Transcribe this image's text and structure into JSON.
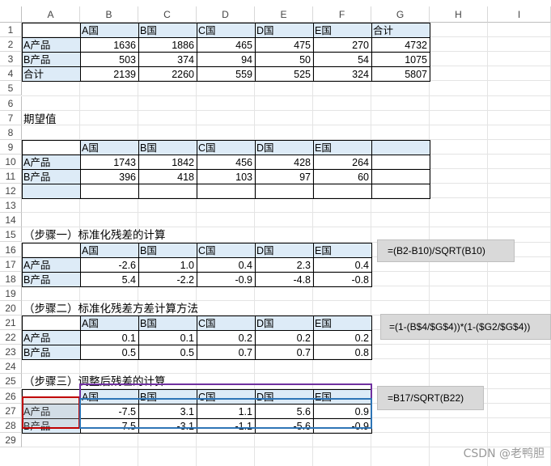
{
  "columns": [
    "A",
    "B",
    "C",
    "D",
    "E",
    "F",
    "G",
    "H",
    "I"
  ],
  "rows": [
    "1",
    "2",
    "3",
    "4",
    "5",
    "6",
    "7",
    "8",
    "9",
    "10",
    "11",
    "12",
    "13",
    "14",
    "15",
    "16",
    "17",
    "18",
    "19",
    "20",
    "21",
    "22",
    "23",
    "24",
    "25",
    "26",
    "27",
    "28",
    "29"
  ],
  "table1": {
    "header": [
      "A国",
      "B国",
      "C国",
      "D国",
      "E国",
      "合计"
    ],
    "rows": [
      {
        "label": "A产品",
        "values": [
          "1636",
          "1886",
          "465",
          "475",
          "270",
          "4732"
        ]
      },
      {
        "label": "B产品",
        "values": [
          "503",
          "374",
          "94",
          "50",
          "54",
          "1075"
        ]
      },
      {
        "label": "合计",
        "values": [
          "2139",
          "2260",
          "559",
          "525",
          "324",
          "5807"
        ]
      }
    ]
  },
  "expected_title": "期望值",
  "table2": {
    "header": [
      "A国",
      "B国",
      "C国",
      "D国",
      "E国"
    ],
    "rows": [
      {
        "label": "A产品",
        "values": [
          "1743",
          "1842",
          "456",
          "428",
          "264"
        ]
      },
      {
        "label": "B产品",
        "values": [
          "396",
          "418",
          "103",
          "97",
          "60"
        ]
      }
    ]
  },
  "step1_title": "（步骤一）标准化残差的计算",
  "table3": {
    "header": [
      "A国",
      "B国",
      "C国",
      "D国",
      "E国"
    ],
    "rows": [
      {
        "label": "A产品",
        "values": [
          "-2.6",
          "1.0",
          "0.4",
          "2.3",
          "0.4"
        ]
      },
      {
        "label": "B产品",
        "values": [
          "5.4",
          "-2.2",
          "-0.9",
          "-4.8",
          "-0.8"
        ]
      }
    ]
  },
  "formula1": "=(B2-B10)/SQRT(B10)",
  "step2_title": "（步骤二）标准化残差方差计算方法",
  "table4": {
    "header": [
      "A国",
      "B国",
      "C国",
      "D国",
      "E国"
    ],
    "rows": [
      {
        "label": "A产品",
        "values": [
          "0.1",
          "0.1",
          "0.2",
          "0.2",
          "0.2"
        ]
      },
      {
        "label": "B产品",
        "values": [
          "0.5",
          "0.5",
          "0.7",
          "0.7",
          "0.8"
        ]
      }
    ]
  },
  "formula2": "=(1-(B$4/$G$4))*(1-($G2/$G$4))",
  "step3_title": "（步骤三）调整后残差的计算",
  "table5": {
    "header": [
      "A国",
      "B国",
      "C国",
      "D国",
      "E国"
    ],
    "rows": [
      {
        "label": "A产品",
        "values": [
          "-7.5",
          "3.1",
          "1.1",
          "5.6",
          "0.9"
        ]
      },
      {
        "label": "B产品",
        "values": [
          "7.5",
          "-3.1",
          "-1.1",
          "-5.6",
          "-0.9"
        ]
      }
    ]
  },
  "formula3": "=B17/SQRT(B22)",
  "watermark": "CSDN @老鸭胆",
  "colors": {
    "header_fill": "#ddebf7",
    "ref_red": "#c00000",
    "ref_purple": "#7030a0",
    "ref_blue": "#2e75b6"
  }
}
